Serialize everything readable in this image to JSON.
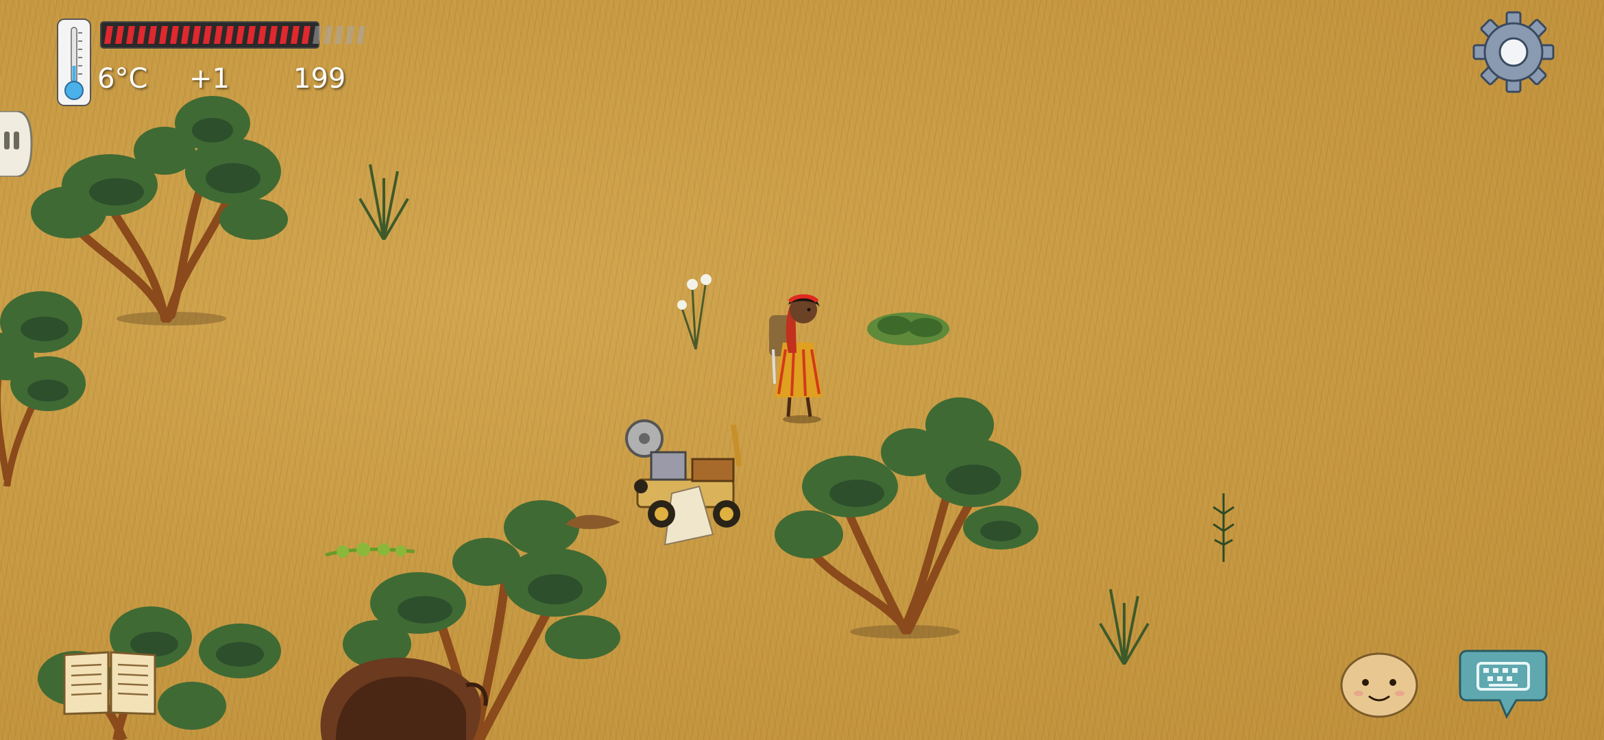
{
  "hud": {
    "temperature": "6°C",
    "yum_bonus": "+1",
    "age_counter": "199",
    "food": {
      "filled_pips": 19,
      "total_pips": 24,
      "filled_color": "#e0282f",
      "empty_color": "#a8a8a8"
    },
    "thermometer_color": "#4ab0e8"
  },
  "icons": {
    "settings": "gear-icon",
    "side_tab": "side-tab-icon",
    "book": "recipe-book-icon",
    "emote": "emote-face-icon",
    "keyboard": "keyboard-chat-icon"
  },
  "scene": {
    "ground_color": "#c99b44",
    "objects": [
      "player-character",
      "crank-wagon",
      "bison",
      "juniper-tree",
      "milkweed",
      "wild-onion",
      "gooseberry-bush",
      "burdock",
      "tule-reeds"
    ]
  }
}
